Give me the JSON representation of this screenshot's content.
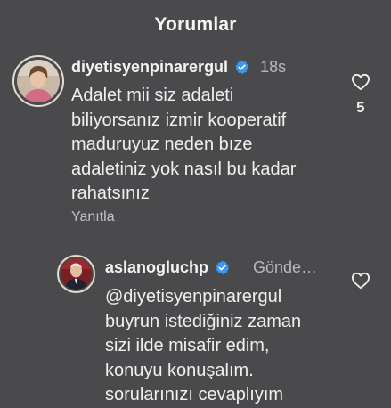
{
  "header": {
    "title": "Yorumlar"
  },
  "comments": [
    {
      "username": "diyetisyenpinarergul",
      "verified": true,
      "time": "18s",
      "lines": [
        "Adalet mii siz adaleti",
        "biliyorsanız izmir kooperatif",
        "maduruyuz neden bıze",
        "adaletiniz yok  nasıl bu kadar",
        "rahatsınız"
      ],
      "reply_label": "Yanıtla",
      "like_icon": "heart-outline-icon",
      "like_count": "5"
    },
    {
      "username": "aslanogluchp",
      "verified": true,
      "time": "Gönde…",
      "lines": [
        "@diyetisyenpinarergul",
        "buyrun istediğiniz zaman",
        "sizi ilde misafir edim,",
        "konuyu konuşalım.",
        "sorularınızı cevaplıyım"
      ],
      "like_icon": "heart-outline-icon"
    }
  ],
  "colors": {
    "background": "#4a4a4d",
    "text": "#f0f0f0",
    "secondary_text": "#b9b9bc",
    "verified_badge": "#3897f0"
  }
}
